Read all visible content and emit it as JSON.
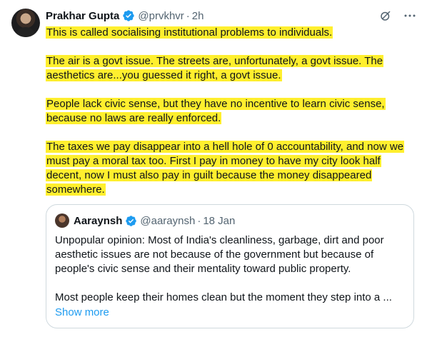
{
  "tweet": {
    "author_name": "Prakhar Gupta",
    "handle": "@prvkhvr",
    "dot": "·",
    "time": "2h",
    "verified_icon": "verified-badge-icon",
    "paragraphs": [
      "This is called socialising institutional problems to individuals.",
      "The air is a govt issue. The streets are, unfortunately, a govt issue. The aesthetics are...you guessed it right, a govt issue.",
      "People lack civic sense, but they have no incentive to learn civic sense, because no laws are really enforced.",
      "The taxes we pay disappear into a hell hole of 0 accountability, and now we must pay a moral tax too. First I pay in money to have my city look half decent, now I must also pay in guilt because the money disappeared somewhere."
    ],
    "highlight_color": "#ffef2e",
    "actions": [
      "grok-icon",
      "more-options-icon"
    ]
  },
  "quote": {
    "author_name": "Aaraynsh",
    "handle": "@aaraynsh",
    "dot": "·",
    "time": "18 Jan",
    "verified_icon": "verified-badge-icon",
    "paragraphs": [
      "Unpopular opinion: Most of India's cleanliness, garbage, dirt and poor aesthetic issues are not because of the government but because of people's civic sense and their mentality toward public property.",
      "Most people keep their homes clean but the moment they step into a ..."
    ],
    "show_more": "Show more"
  },
  "colors": {
    "text": "#0f1419",
    "secondary": "#536471",
    "accent": "#1d9bf0",
    "border": "#cfd9de"
  }
}
